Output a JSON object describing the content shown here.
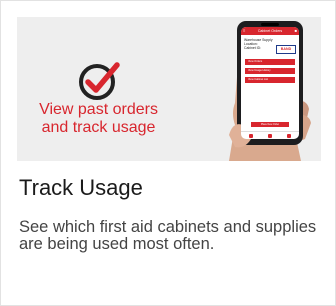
{
  "hero": {
    "caption": "View past orders and track usage",
    "phone": {
      "header_title": "Cabinet Orders",
      "subtitle_lines": [
        "Warehouse Supply",
        "Location:",
        "Cabinet ID:"
      ],
      "logo": "BAND",
      "buttons": [
        "View Orders",
        "View Usage History",
        "View Cabinet List"
      ],
      "footer_button": "Place New Order"
    }
  },
  "card": {
    "title": "Track Usage",
    "description": "See which first aid cabinets and supplies are being used most often."
  },
  "colors": {
    "accent": "#d8262e",
    "hero_bg": "#eeeeee",
    "title": "#1b1b1b",
    "body_text": "#444444"
  }
}
